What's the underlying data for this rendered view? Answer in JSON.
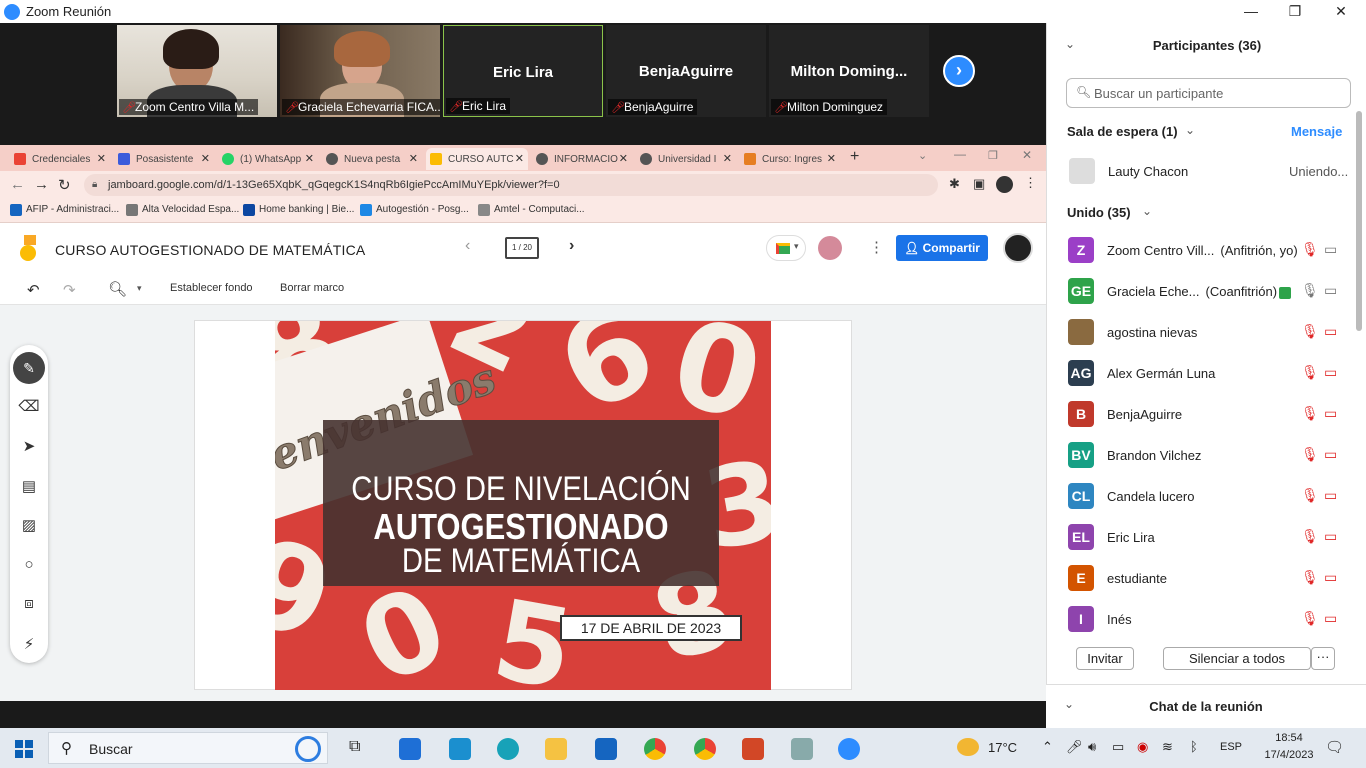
{
  "window": {
    "title": "Zoom Reunión"
  },
  "videos": [
    {
      "name": "Zoom Centro Villa M...",
      "type": "photo"
    },
    {
      "name": "Graciela Echevarria FICA...",
      "type": "photo"
    },
    {
      "name": "Eric Lira",
      "big": "Eric Lira"
    },
    {
      "name": "BenjaAguirre",
      "big": "BenjaAguirre"
    },
    {
      "name": "Milton Dominguez",
      "big": "Milton  Doming..."
    }
  ],
  "browser": {
    "tabs": [
      "Credenciales",
      "Posasistente",
      "(1) WhatsApp",
      "Nueva pesta",
      "CURSO AUTC",
      "INFORMACIO",
      "Universidad I",
      "Curso: Ingres"
    ],
    "url": "jamboard.google.com/d/1-13Ge65XqbK_qGqegcK1S4nqRb6IgiePccAmIMuYEpk/viewer?f=0",
    "bookmarks": [
      "AFIP - Administraci...",
      "Alta Velocidad Espa...",
      "Home banking | Bie...",
      "Autogestión - Posg...",
      "Amtel - Computaci..."
    ]
  },
  "jamboard": {
    "title": "CURSO AUTOGESTIONADO DE MATEMÁTICA",
    "frame_counter": "1 / 20",
    "share_label": "Compartir",
    "toolbar": {
      "set_background": "Establecer fondo",
      "clear_frame": "Borrar marco"
    },
    "slide": {
      "welcome": "Bienvenidos",
      "line1": "CURSO DE NIVELACIÓN",
      "line2": "AUTOGESTIONADO",
      "line3": "DE MATEMÁTICA",
      "date": "17 DE ABRIL DE 2023"
    }
  },
  "participants": {
    "header": "Participantes (36)",
    "search_placeholder": "Buscar un participante",
    "waiting": {
      "label": "Sala de espera (1)",
      "message": "Mensaje",
      "person": "Lauty Chacon",
      "status": "Uniendo..."
    },
    "joined_label": "Unido (35)",
    "list": [
      {
        "initials": "Z",
        "name": "Zoom Centro Vill...",
        "role": "(Anfitrión, yo)",
        "color": "#9b3fc7"
      },
      {
        "initials": "GE",
        "name": "Graciela Eche...",
        "role": "(Coanfitrión)",
        "color": "#2ea34a"
      },
      {
        "initials": "",
        "name": "agostina nievas",
        "role": "",
        "color": "#8a6a40"
      },
      {
        "initials": "AG",
        "name": "Alex Germán Luna",
        "role": "",
        "color": "#2c3e50"
      },
      {
        "initials": "B",
        "name": "BenjaAguirre",
        "role": "",
        "color": "#c0392b"
      },
      {
        "initials": "BV",
        "name": "Brandon Vilchez",
        "role": "",
        "color": "#16a085"
      },
      {
        "initials": "CL",
        "name": "Candela lucero",
        "role": "",
        "color": "#2e86c1"
      },
      {
        "initials": "EL",
        "name": "Eric Lira",
        "role": "",
        "color": "#8e44ad"
      },
      {
        "initials": "E",
        "name": "estudiante",
        "role": "",
        "color": "#d35400"
      },
      {
        "initials": "I",
        "name": "Inés",
        "role": "",
        "color": "#8e44ad"
      }
    ],
    "invite": "Invitar",
    "mute_all": "Silenciar a todos",
    "more": "···",
    "chat": "Chat de la reunión"
  },
  "taskbar": {
    "search": "Buscar",
    "weather": "17°C",
    "lang": "ESP",
    "time": "18:54",
    "date": "17/4/2023"
  }
}
